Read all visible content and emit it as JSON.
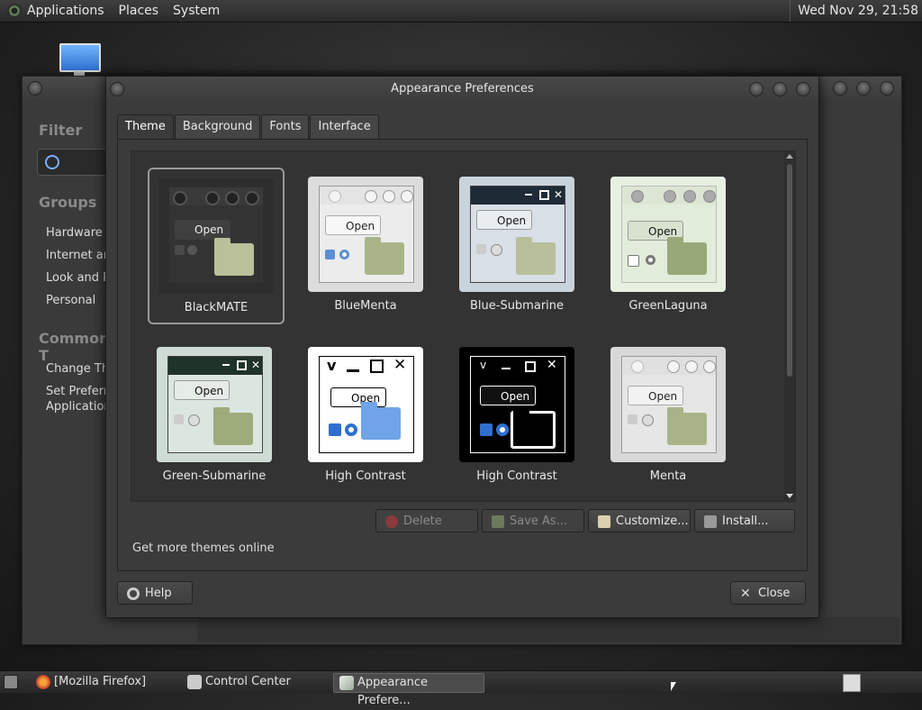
{
  "top_panel": {
    "menus": [
      "Applications",
      "Places",
      "System"
    ],
    "clock": "Wed Nov 29, 21:58"
  },
  "control_center": {
    "filter_heading": "Filter",
    "groups_heading": "Groups",
    "groups": [
      "Hardware",
      "Internet an",
      "Look and F",
      "Personal"
    ],
    "common_heading": "Common T",
    "common": [
      "Change Th",
      "Set Preferre",
      "Application"
    ]
  },
  "dialog": {
    "title": "Appearance Preferences",
    "tabs": [
      "Theme",
      "Background",
      "Fonts",
      "Interface"
    ],
    "themes": [
      {
        "name": "BlackMATE",
        "selected": true
      },
      {
        "name": "BlueMenta",
        "selected": false
      },
      {
        "name": "Blue-Submarine",
        "selected": false
      },
      {
        "name": "GreenLaguna",
        "selected": false
      },
      {
        "name": "Green-Submarine",
        "selected": false
      },
      {
        "name": "High Contrast",
        "selected": false
      },
      {
        "name": "High Contrast",
        "selected": false
      },
      {
        "name": "Menta",
        "selected": false
      }
    ],
    "preview_open_label": "Open",
    "buttons": {
      "delete": "Delete",
      "save_as": "Save As...",
      "customize": "Customize...",
      "install": "Install..."
    },
    "more_themes": "Get more themes online",
    "help": "Help",
    "close": "Close"
  },
  "taskbar": {
    "tasks": [
      "[Mozilla Firefox]",
      "Control Center",
      "Appearance Prefere..."
    ]
  }
}
